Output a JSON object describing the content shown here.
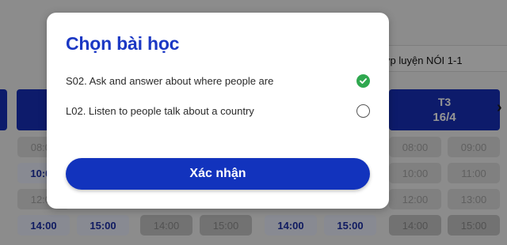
{
  "background": {
    "tab_label": "ớp luyện NÓI 1-1",
    "days": [
      {
        "name": "",
        "date": ""
      },
      {
        "name": "",
        "date": ""
      },
      {
        "name": "T3",
        "date": "16/4"
      }
    ],
    "slots": {
      "row1": [
        "08:00",
        "",
        "",
        "",
        "",
        "",
        "08:00",
        "09:00"
      ],
      "row2": [
        "10:00",
        "",
        "",
        "",
        "",
        "",
        "10:00",
        "11:00"
      ],
      "row3": [
        "12:00",
        "",
        "",
        "",
        "",
        "",
        "12:00",
        "13:00"
      ],
      "row4": [
        "14:00",
        "15:00",
        "14:00",
        "15:00",
        "14:00",
        "15:00",
        "14:00",
        "15:00"
      ]
    }
  },
  "modal": {
    "title": "Chọn bài học",
    "lessons": [
      {
        "label": "S02. Ask and answer about where people are",
        "selected": true
      },
      {
        "label": "L02. Listen to people talk about a country",
        "selected": false
      }
    ],
    "confirm_label": "Xác nhận"
  },
  "colors": {
    "primary": "#1233bd",
    "title": "#1b38c4",
    "check": "#2fa84f"
  }
}
